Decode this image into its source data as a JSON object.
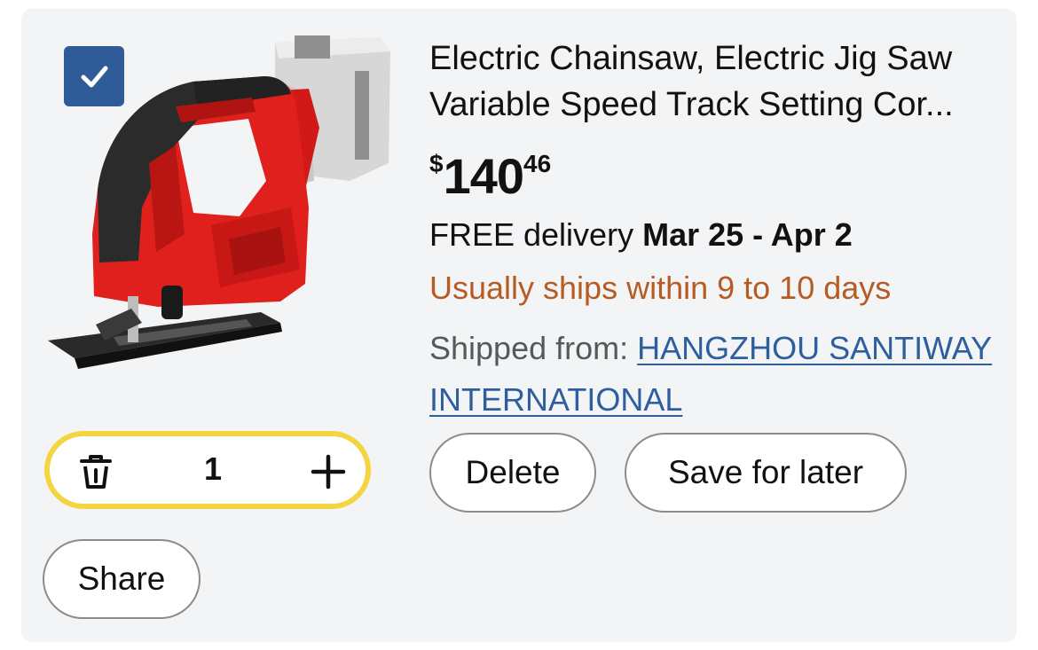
{
  "cart_item": {
    "selected": true,
    "image_alt": "cordless jig saw",
    "title": "Electric Chainsaw, Electric Jig Saw Variable Speed Track Setting Cor...",
    "price": {
      "currency": "$",
      "whole": "140",
      "fraction": "46"
    },
    "delivery": {
      "prefix": "FREE delivery",
      "dates": "Mar 25 - Apr 2"
    },
    "ships_notice": "Usually ships within 9 to 10 days",
    "shipped_from": {
      "label": "Shipped from:",
      "seller": "HANGZHOU SANTIWAY INTERNATIONAL"
    },
    "quantity": "1",
    "actions": {
      "delete_label": "Delete",
      "save_label": "Save for later",
      "share_label": "Share"
    }
  },
  "icons": {
    "checkbox": "checkmark-icon",
    "remove": "trash-icon",
    "increment": "plus-icon"
  },
  "colors": {
    "checkbox_bg": "#2f5c98",
    "ships_notice": "#b65b22",
    "seller_link": "#2d5f9e",
    "stepper_border": "#f5d442",
    "product_red": "#e0201c"
  }
}
